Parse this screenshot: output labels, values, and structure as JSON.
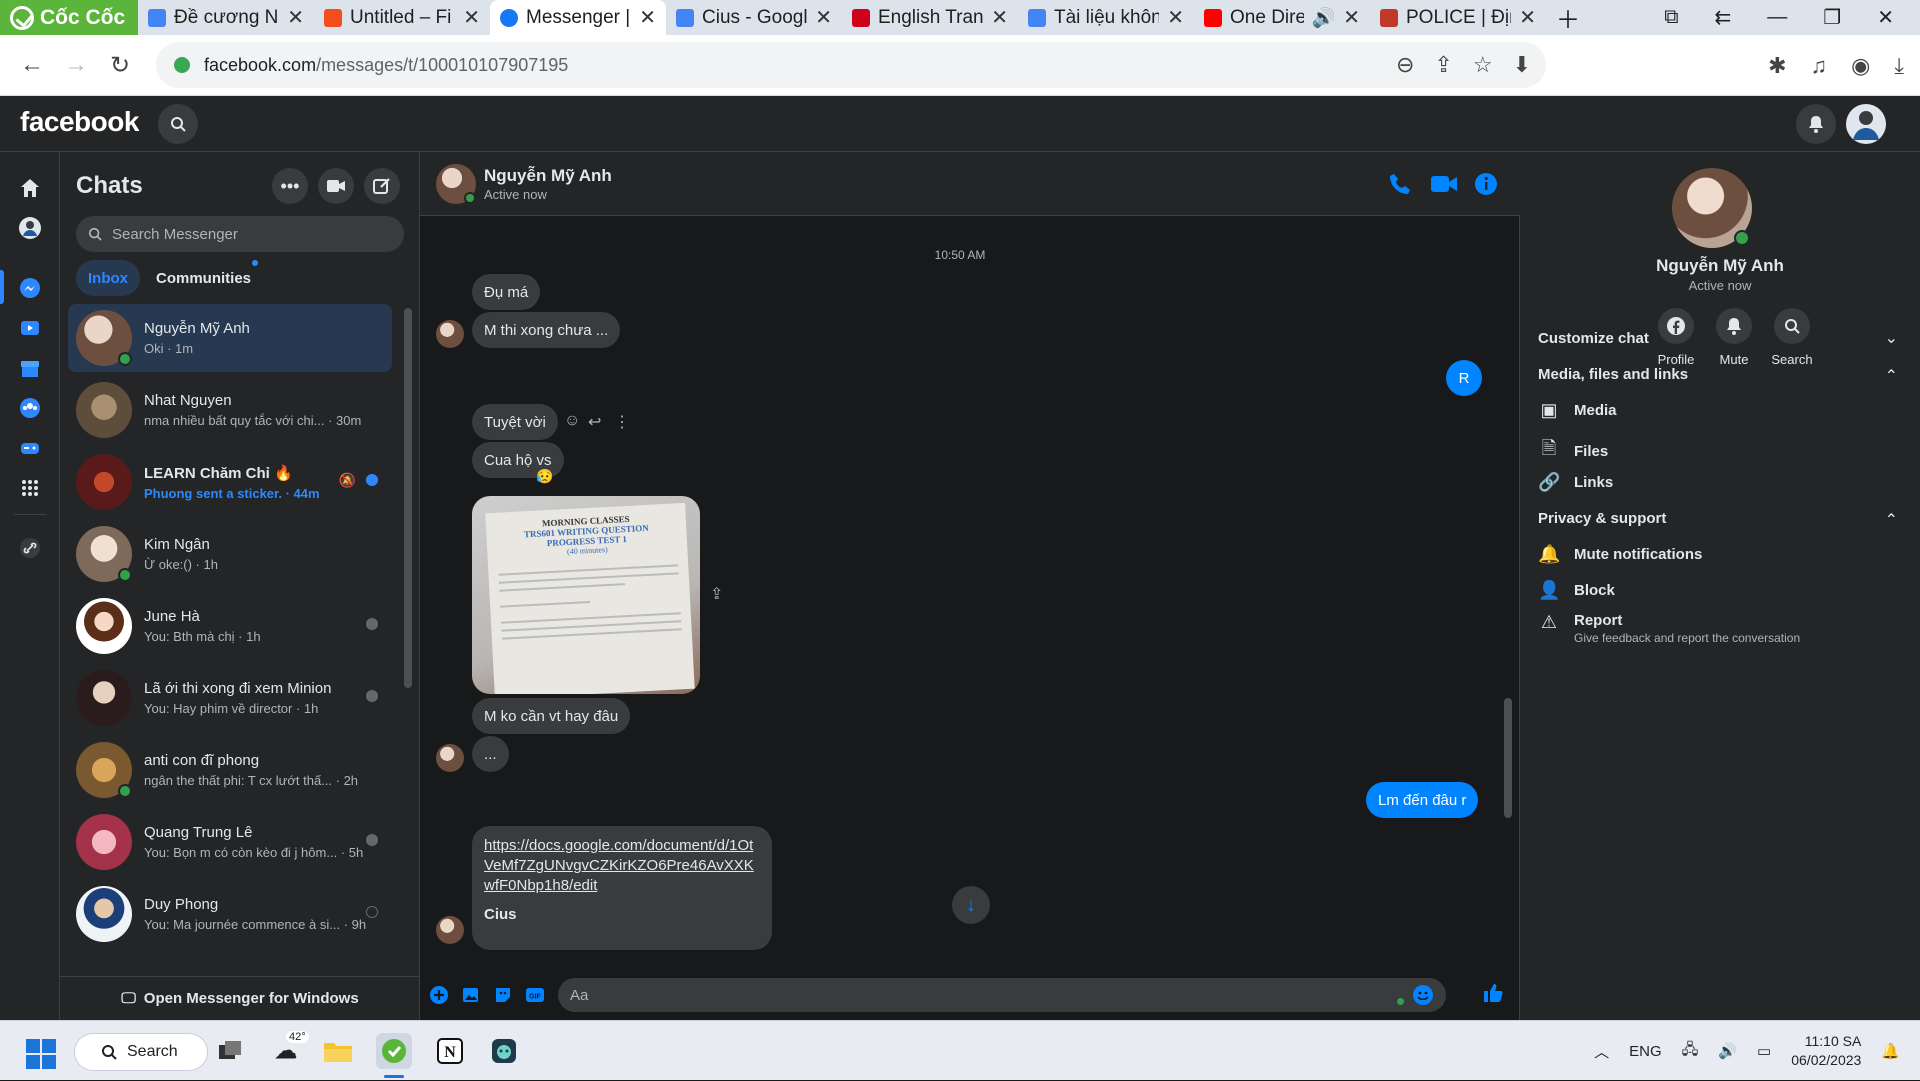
{
  "browser": {
    "brand": "Cốc Cốc",
    "tabs": [
      {
        "title": "Đề cương N",
        "icon": "google-docs-icon",
        "color": "#4285f4",
        "active": false
      },
      {
        "title": "Untitled – Fi",
        "icon": "figma-icon",
        "color": "#f24e1e",
        "active": false
      },
      {
        "title": "Messenger |",
        "icon": "facebook-icon",
        "color": "#1877f2",
        "active": true
      },
      {
        "title": "Cius - Googl",
        "icon": "google-docs-icon",
        "color": "#4285f4",
        "active": false
      },
      {
        "title": "English Trans",
        "icon": "cambridge-icon",
        "color": "#d0021b",
        "active": false
      },
      {
        "title": "Tài liệu khôn",
        "icon": "google-docs-icon",
        "color": "#4285f4",
        "active": false
      },
      {
        "title": "One Dire",
        "icon": "youtube-icon",
        "color": "#ff0000",
        "active": false
      },
      {
        "title": "POLICE | Địn",
        "icon": "cambridge-dictionary-icon",
        "color": "#c0392b",
        "active": false
      }
    ],
    "url_host": "facebook.com",
    "url_path": "/messages/t/100010107907195"
  },
  "facebook": {
    "logo": "facebook"
  },
  "chatlist": {
    "title": "Chats",
    "search_placeholder": "Search Messenger",
    "tabs": [
      "Inbox",
      "Communities"
    ],
    "open_windows": "Open Messenger for Windows",
    "items": [
      {
        "name": "Nguyễn Mỹ Anh",
        "preview": "Oki · 1m",
        "online": true,
        "selected": true,
        "unread": false,
        "avatar_color": "#8a6d5d"
      },
      {
        "name": "Nhat Nguyen",
        "preview": "nma nhiều bất quy tắc với chi... · 30m",
        "online": false,
        "selected": false,
        "unread": false,
        "avatar_color": "#6b5a48"
      },
      {
        "name": "LEARN Chăm Chỉ 🔥",
        "preview": "Phuong sent a sticker. · 44m",
        "online": false,
        "selected": false,
        "unread": true,
        "avatar_color": "#7a2a2a"
      },
      {
        "name": "Kim Ngân",
        "preview": "Ừ oke:() · 1h",
        "online": true,
        "selected": false,
        "unread": false,
        "avatar_color": "#c9b9a8"
      },
      {
        "name": "June Hà",
        "preview": "You: Bth mà chị · 1h",
        "online": false,
        "selected": false,
        "unread": false,
        "avatar_color": "#f2e6dc"
      },
      {
        "name": "Lã ới thi xong đi xem Minion",
        "preview": "You: Hay phim về director · 1h",
        "online": false,
        "selected": false,
        "unread": false,
        "avatar_color": "#3d2a2a"
      },
      {
        "name": "anti con đĩ phong",
        "preview": "ngân the thất phi: T cx lướt thấ... · 2h",
        "online": true,
        "selected": false,
        "unread": false,
        "avatar_color": "#b5833c"
      },
      {
        "name": "Quang Trung Lê",
        "preview": "You: Bọn m có còn kèo đi j hôm... · 5h",
        "online": false,
        "selected": false,
        "unread": false,
        "avatar_color": "#d66a7c"
      },
      {
        "name": "Duy Phong",
        "preview": "You: Ma journée commence à si... · 9h",
        "online": false,
        "selected": false,
        "unread": false,
        "avatar_color": "#e8eef5"
      }
    ]
  },
  "conversation": {
    "contact_name": "Nguyễn Mỹ Anh",
    "contact_status": "Active now",
    "timestamp": "10:50 AM",
    "messages": [
      {
        "text": "Đụ má",
        "from": "them"
      },
      {
        "text": "M thi xong chưa ...",
        "from": "them"
      },
      {
        "text": "R",
        "from": "me"
      },
      {
        "text": "Tuyệt vời",
        "from": "them"
      },
      {
        "text": "Cua hộ vs",
        "from": "them"
      },
      {
        "text": "M ko cần vt hay đâu",
        "from": "them"
      },
      {
        "text": "...",
        "from": "them"
      },
      {
        "text": "Lm đến đâu r",
        "from": "me"
      }
    ],
    "reaction_emoji": "😥",
    "image_text": {
      "line1": "MORNING CLASSES",
      "line2": "TRS601 WRITING QUESTION",
      "line3": "PROGRESS TEST 1",
      "line4": "(40 minutes)"
    },
    "link_preview": {
      "url": "https://docs.google.com/document/d/1OtVeMf7ZgUNvgvCZKirKZO6Pre46AvXXKwfF0Nbp1h8/edit",
      "title": "Cius"
    },
    "composer_placeholder": "Aa"
  },
  "info_panel": {
    "name": "Nguyễn Mỹ Anh",
    "status": "Active now",
    "quick_actions": [
      {
        "label": "Profile",
        "icon": "facebook-icon"
      },
      {
        "label": "Mute",
        "icon": "bell-icon"
      },
      {
        "label": "Search",
        "icon": "search-icon"
      }
    ],
    "customize_chat": "Customize chat",
    "media_section": "Media, files and links",
    "media_items": [
      {
        "label": "Media",
        "icon": "image-icon"
      },
      {
        "label": "Files",
        "icon": "file-icon"
      },
      {
        "label": "Links",
        "icon": "link-icon"
      }
    ],
    "privacy_section": "Privacy & support",
    "privacy_items": [
      {
        "label": "Mute notifications",
        "icon": "bell-icon"
      },
      {
        "label": "Block",
        "icon": "block-user-icon"
      }
    ],
    "report_label": "Report",
    "report_sub": "Give feedback and report the conversation"
  },
  "taskbar": {
    "search_label": "Search",
    "weather": "42°",
    "language": "ENG",
    "time": "11:10 SA",
    "date": "06/02/2023"
  },
  "colors": {
    "messenger_blue": "#0084ff",
    "facebook_blue": "#1877f2",
    "online_green": "#31a24c",
    "selected_row": "#263951"
  }
}
